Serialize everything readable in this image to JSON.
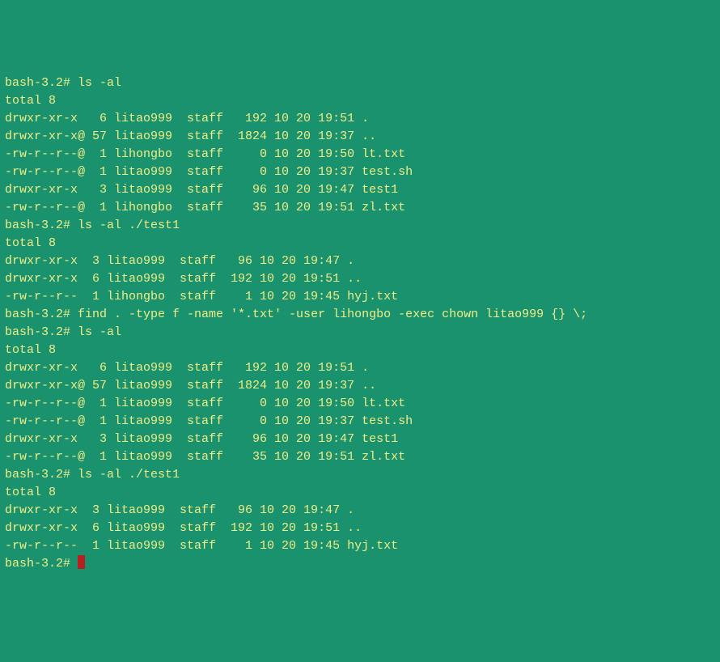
{
  "prompt": "bash-3.2# ",
  "cmd1": "ls -al",
  "ls1": {
    "total": "total 8",
    "rows": [
      "drwxr-xr-x   6 litao999  staff   192 10 20 19:51 .",
      "drwxr-xr-x@ 57 litao999  staff  1824 10 20 19:37 ..",
      "-rw-r--r--@  1 lihongbo  staff     0 10 20 19:50 lt.txt",
      "-rw-r--r--@  1 litao999  staff     0 10 20 19:37 test.sh",
      "drwxr-xr-x   3 litao999  staff    96 10 20 19:47 test1",
      "-rw-r--r--@  1 lihongbo  staff    35 10 20 19:51 zl.txt"
    ]
  },
  "cmd2": "ls -al ./test1",
  "ls2": {
    "total": "total 8",
    "rows": [
      "drwxr-xr-x  3 litao999  staff   96 10 20 19:47 .",
      "drwxr-xr-x  6 litao999  staff  192 10 20 19:51 ..",
      "-rw-r--r--  1 lihongbo  staff    1 10 20 19:45 hyj.txt"
    ]
  },
  "cmd3": "find . -type f -name '*.txt' -user lihongbo -exec chown litao999 {} \\;",
  "blank": "",
  "cmd4": "ls -al",
  "ls3": {
    "total": "total 8",
    "rows": [
      "drwxr-xr-x   6 litao999  staff   192 10 20 19:51 .",
      "drwxr-xr-x@ 57 litao999  staff  1824 10 20 19:37 ..",
      "-rw-r--r--@  1 litao999  staff     0 10 20 19:50 lt.txt",
      "-rw-r--r--@  1 litao999  staff     0 10 20 19:37 test.sh",
      "drwxr-xr-x   3 litao999  staff    96 10 20 19:47 test1",
      "-rw-r--r--@  1 litao999  staff    35 10 20 19:51 zl.txt"
    ]
  },
  "cmd5": "ls -al ./test1",
  "ls4": {
    "total": "total 8",
    "rows": [
      "drwxr-xr-x  3 litao999  staff   96 10 20 19:47 .",
      "drwxr-xr-x  6 litao999  staff  192 10 20 19:51 ..",
      "-rw-r--r--  1 litao999  staff    1 10 20 19:45 hyj.txt"
    ]
  }
}
